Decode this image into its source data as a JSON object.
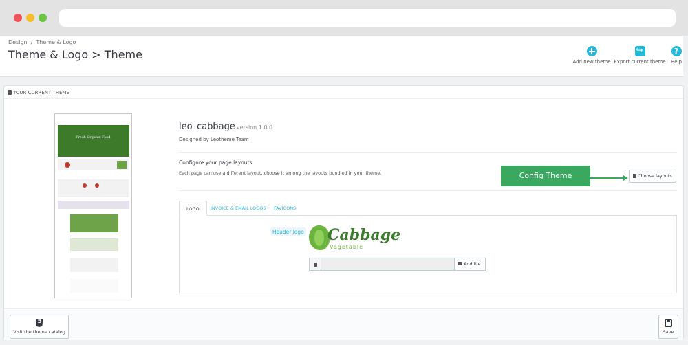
{
  "breadcrumb": {
    "parent": "Design",
    "separator": "/",
    "current": "Theme & Logo"
  },
  "page_title": "Theme & Logo > Theme",
  "toolbar": {
    "add_new_theme": "Add new theme",
    "export_current_theme": "Export current theme",
    "help": "Help"
  },
  "panel": {
    "heading": "YOUR CURRENT THEME",
    "theme_name": "leo_cabbage",
    "theme_version": "version 1.0.0",
    "theme_author": "Designed by Leotheme Team",
    "layouts_title": "Configure your page layouts",
    "layouts_desc": "Each page can use a different layout, choose it among the layouts bundled in your theme.",
    "choose_layouts": "Choose layouts",
    "callout": "Config Theme",
    "preview_hero_text": "Fresh Organic Food"
  },
  "tabs": [
    {
      "label": "LOGO",
      "active": true
    },
    {
      "label": "INVOICE & EMAIL LOGOS",
      "active": false
    },
    {
      "label": "FAVICONS",
      "active": false
    }
  ],
  "logo": {
    "header_logo_label": "Header logo",
    "logo_text": "Cabbage",
    "logo_sub": "Vegetable",
    "add_file": "Add file"
  },
  "footer": {
    "visit_catalog": "Visit the theme catalog",
    "save": "Save"
  },
  "colors": {
    "accent": "#25b9d7",
    "callout": "#3aa85f"
  }
}
